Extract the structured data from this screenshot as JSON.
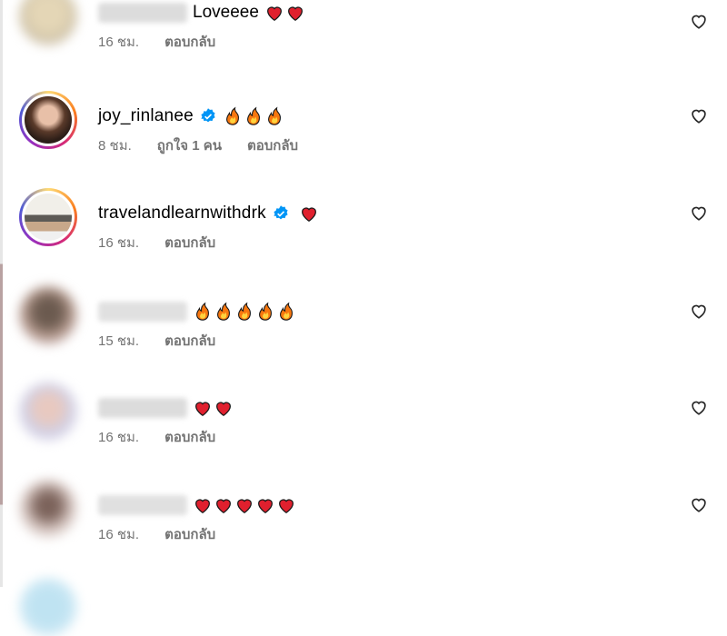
{
  "comments": [
    {
      "username": "",
      "username_blurred": true,
      "text": "Loveeee",
      "emoji": [
        "heart",
        "heart"
      ],
      "verified": false,
      "time": "16 ชม.",
      "likes": "",
      "reply": "ตอบกลับ"
    },
    {
      "username": "joy_rinlanee",
      "username_blurred": false,
      "text": "",
      "emoji": [
        "fire",
        "fire",
        "fire"
      ],
      "verified": true,
      "time": "8 ชม.",
      "likes": "ถูกใจ 1 คน",
      "reply": "ตอบกลับ"
    },
    {
      "username": "travelandlearnwithdrk",
      "username_blurred": false,
      "text": "",
      "emoji": [
        "heart"
      ],
      "verified": true,
      "time": "16 ชม.",
      "likes": "",
      "reply": "ตอบกลับ"
    },
    {
      "username": "",
      "username_blurred": true,
      "text": "",
      "emoji": [
        "fire",
        "fire",
        "fire",
        "fire",
        "fire"
      ],
      "verified": false,
      "time": "15 ชม.",
      "likes": "",
      "reply": "ตอบกลับ"
    },
    {
      "username": "",
      "username_blurred": true,
      "text": "",
      "emoji": [
        "heart",
        "heart"
      ],
      "verified": false,
      "time": "16 ชม.",
      "likes": "",
      "reply": "ตอบกลับ"
    },
    {
      "username": "",
      "username_blurred": true,
      "text": "",
      "emoji": [
        "heart",
        "heart",
        "heart",
        "heart",
        "heart"
      ],
      "verified": false,
      "time": "16 ชม.",
      "likes": "",
      "reply": "ตอบกลับ"
    }
  ],
  "colors": {
    "verified": "#0095f6",
    "meta": "#737373",
    "heart_emoji": "#e0202e",
    "fire_emoji": "#f7770f"
  }
}
